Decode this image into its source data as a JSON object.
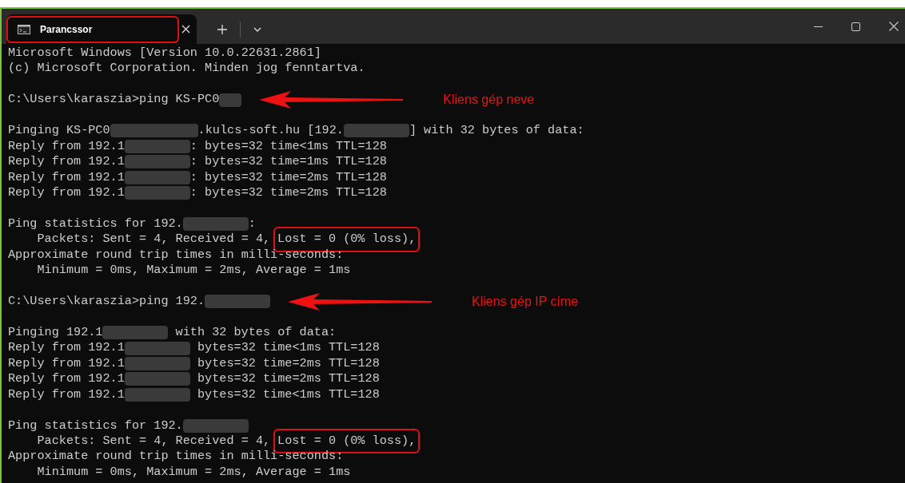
{
  "tab": {
    "title": "Parancssor",
    "highlighted": true
  },
  "lines": [
    {
      "kind": "output",
      "parts": [
        {
          "kind": "text",
          "text": "Microsoft Windows [Version 10.0.22631.2861]"
        }
      ]
    },
    {
      "kind": "output",
      "parts": [
        {
          "kind": "text",
          "text": "(c) Microsoft Corporation. Minden jog fenntartva."
        }
      ]
    },
    {
      "kind": "blank"
    },
    {
      "kind": "output",
      "parts": [
        {
          "kind": "text",
          "text": "C:\\Users\\karaszia>ping KS-PC0"
        },
        {
          "kind": "redacted-short"
        }
      ],
      "note": "Kliens gép neve"
    },
    {
      "kind": "blank"
    },
    {
      "kind": "output",
      "parts": [
        {
          "kind": "text",
          "text": "Pinging KS-PC0"
        },
        {
          "kind": "redacted-long"
        },
        {
          "kind": "text",
          "text": ".kulcs-soft.hu [192."
        },
        {
          "kind": "redacted"
        },
        {
          "kind": "text",
          "text": "] with 32 bytes of data:"
        }
      ]
    },
    {
      "kind": "output",
      "parts": [
        {
          "kind": "text",
          "text": "Reply from 192.1"
        },
        {
          "kind": "redacted"
        },
        {
          "kind": "text",
          "text": ": bytes=32 time<1ms TTL=128"
        }
      ]
    },
    {
      "kind": "output",
      "parts": [
        {
          "kind": "text",
          "text": "Reply from 192.1"
        },
        {
          "kind": "redacted"
        },
        {
          "kind": "text",
          "text": ": bytes=32 time=1ms TTL=128"
        }
      ]
    },
    {
      "kind": "output",
      "parts": [
        {
          "kind": "text",
          "text": "Reply from 192.1"
        },
        {
          "kind": "redacted"
        },
        {
          "kind": "text",
          "text": ": bytes=32 time=2ms TTL=128"
        }
      ]
    },
    {
      "kind": "output",
      "parts": [
        {
          "kind": "text",
          "text": "Reply from 192.1"
        },
        {
          "kind": "redacted"
        },
        {
          "kind": "text",
          "text": ": bytes=32 time=2ms TTL=128"
        }
      ]
    },
    {
      "kind": "blank"
    },
    {
      "kind": "output",
      "parts": [
        {
          "kind": "text",
          "text": "Ping statistics for 192."
        },
        {
          "kind": "redacted"
        },
        {
          "kind": "text",
          "text": ":"
        }
      ]
    },
    {
      "kind": "output",
      "parts": [
        {
          "kind": "text",
          "text": "    Packets: Sent = 4, Received = 4,"
        },
        {
          "kind": "boxed",
          "text": "Lost = 0 (0% loss),"
        }
      ]
    },
    {
      "kind": "output",
      "parts": [
        {
          "kind": "text",
          "text": "Approximate round trip times in milli-seconds:"
        }
      ]
    },
    {
      "kind": "output",
      "parts": [
        {
          "kind": "text",
          "text": "    Minimum = 0ms, Maximum = 2ms, Average = 1ms"
        }
      ]
    },
    {
      "kind": "blank"
    },
    {
      "kind": "output",
      "parts": [
        {
          "kind": "text",
          "text": "C:\\Users\\karaszia>ping 192."
        },
        {
          "kind": "redacted"
        }
      ],
      "note": "Kliens gép IP címe"
    },
    {
      "kind": "blank"
    },
    {
      "kind": "output",
      "parts": [
        {
          "kind": "text",
          "text": "Pinging 192.1"
        },
        {
          "kind": "redacted"
        },
        {
          "kind": "text",
          "text": " with 32 bytes of data:"
        }
      ]
    },
    {
      "kind": "output",
      "parts": [
        {
          "kind": "text",
          "text": "Reply from 192.1"
        },
        {
          "kind": "redacted"
        },
        {
          "kind": "text",
          "text": " bytes=32 time<1ms TTL=128"
        }
      ]
    },
    {
      "kind": "output",
      "parts": [
        {
          "kind": "text",
          "text": "Reply from 192.1"
        },
        {
          "kind": "redacted"
        },
        {
          "kind": "text",
          "text": " bytes=32 time=2ms TTL=128"
        }
      ]
    },
    {
      "kind": "output",
      "parts": [
        {
          "kind": "text",
          "text": "Reply from 192.1"
        },
        {
          "kind": "redacted"
        },
        {
          "kind": "text",
          "text": " bytes=32 time=2ms TTL=128"
        }
      ]
    },
    {
      "kind": "output",
      "parts": [
        {
          "kind": "text",
          "text": "Reply from 192.1"
        },
        {
          "kind": "redacted"
        },
        {
          "kind": "text",
          "text": " bytes=32 time<1ms TTL=128"
        }
      ]
    },
    {
      "kind": "blank"
    },
    {
      "kind": "output",
      "parts": [
        {
          "kind": "text",
          "text": "Ping statistics for 192."
        },
        {
          "kind": "redacted"
        }
      ]
    },
    {
      "kind": "output",
      "parts": [
        {
          "kind": "text",
          "text": "    Packets: Sent = 4, Received = 4,"
        },
        {
          "kind": "boxed",
          "text": "Lost = 0 (0% loss),"
        }
      ]
    },
    {
      "kind": "output",
      "parts": [
        {
          "kind": "text",
          "text": "Approximate round trip times in milli-seconds:"
        }
      ]
    },
    {
      "kind": "output",
      "parts": [
        {
          "kind": "text",
          "text": "    Minimum = 0ms, Maximum = 2ms, Average = 1ms"
        }
      ]
    }
  ]
}
